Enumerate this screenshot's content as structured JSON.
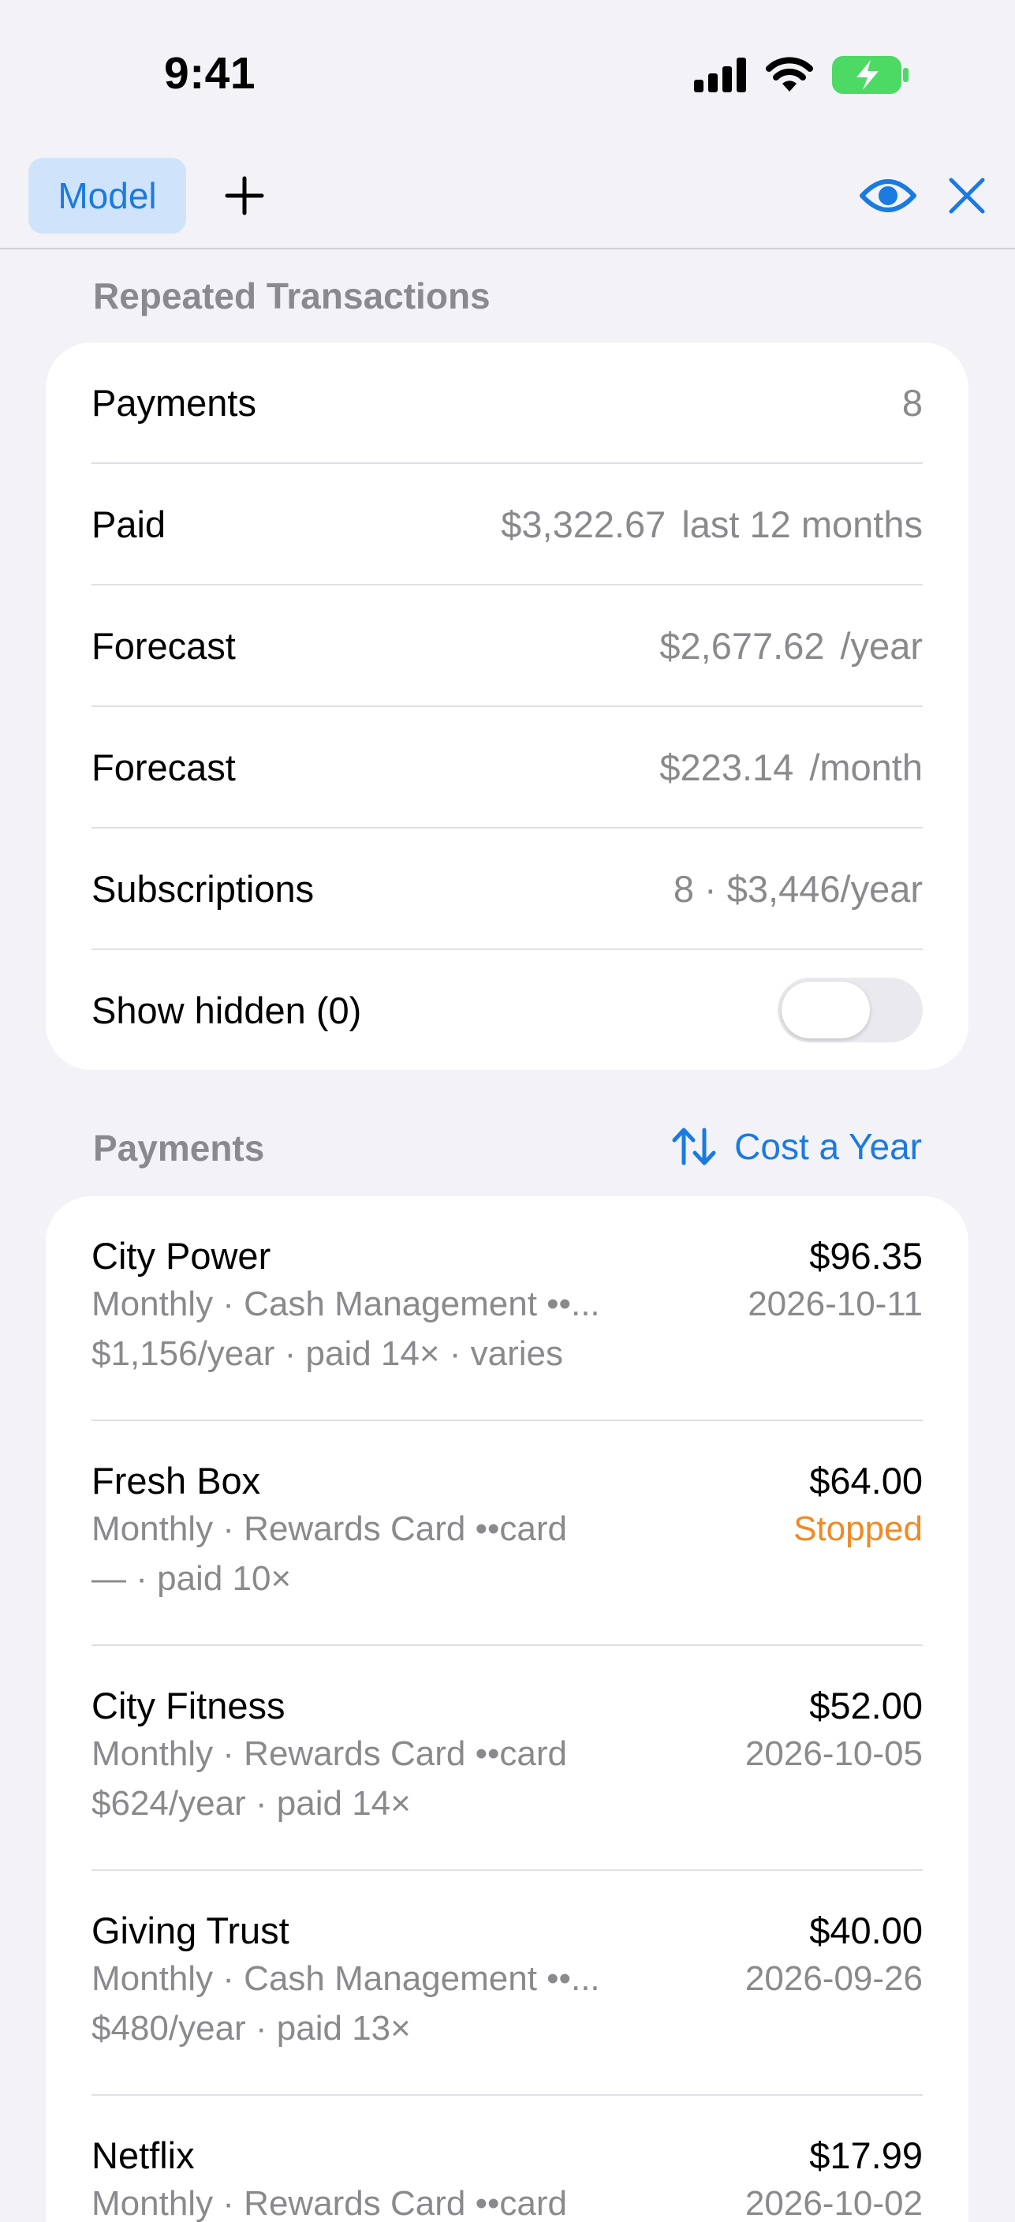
{
  "status_bar": {
    "time": "9:41"
  },
  "toolbar": {
    "model_label": "Model",
    "add_icon": "plus-icon",
    "visibility_icon": "eye-icon",
    "close_icon": "close-icon",
    "accent_color": "#1a7ae0"
  },
  "summary": {
    "title": "Repeated Transactions",
    "rows": [
      {
        "label": "Payments",
        "value": "8",
        "unit": ""
      },
      {
        "label": "Paid",
        "value": "$3,322.67",
        "unit": "last 12 months"
      },
      {
        "label": "Forecast",
        "value": "$2,677.62",
        "unit": "/year"
      },
      {
        "label": "Forecast",
        "value": "$223.14",
        "unit": "/month"
      },
      {
        "label": "Subscriptions",
        "value": "8 · $3,446/year",
        "unit": ""
      }
    ],
    "show_hidden_label": "Show hidden (0)",
    "show_hidden_on": false
  },
  "payments": {
    "title": "Payments",
    "sort_label": "Cost a Year",
    "sort_icon": "sort-arrows-icon",
    "items": [
      {
        "name": "City Power",
        "amount": "$96.35",
        "line1": "Monthly · Cash Management ••...",
        "line2": "$1,156/year · paid 14× · varies",
        "status": "2026-10-11"
      },
      {
        "name": "Fresh Box",
        "amount": "$64.00",
        "line1": "Monthly · Rewards Card ••card",
        "line2": "— · paid 10×",
        "status": "Stopped"
      },
      {
        "name": "City Fitness",
        "amount": "$52.00",
        "line1": "Monthly · Rewards Card ••card",
        "line2": "$624/year · paid 14×",
        "status": "2026-10-05"
      },
      {
        "name": "Giving Trust",
        "amount": "$40.00",
        "line1": "Monthly · Cash Management ••...",
        "line2": "$480/year · paid 13×",
        "status": "2026-09-26"
      },
      {
        "name": "Netflix",
        "amount": "$17.99",
        "line1": "Monthly · Rewards Card ••card",
        "line2": "",
        "status": "2026-10-02"
      }
    ]
  }
}
